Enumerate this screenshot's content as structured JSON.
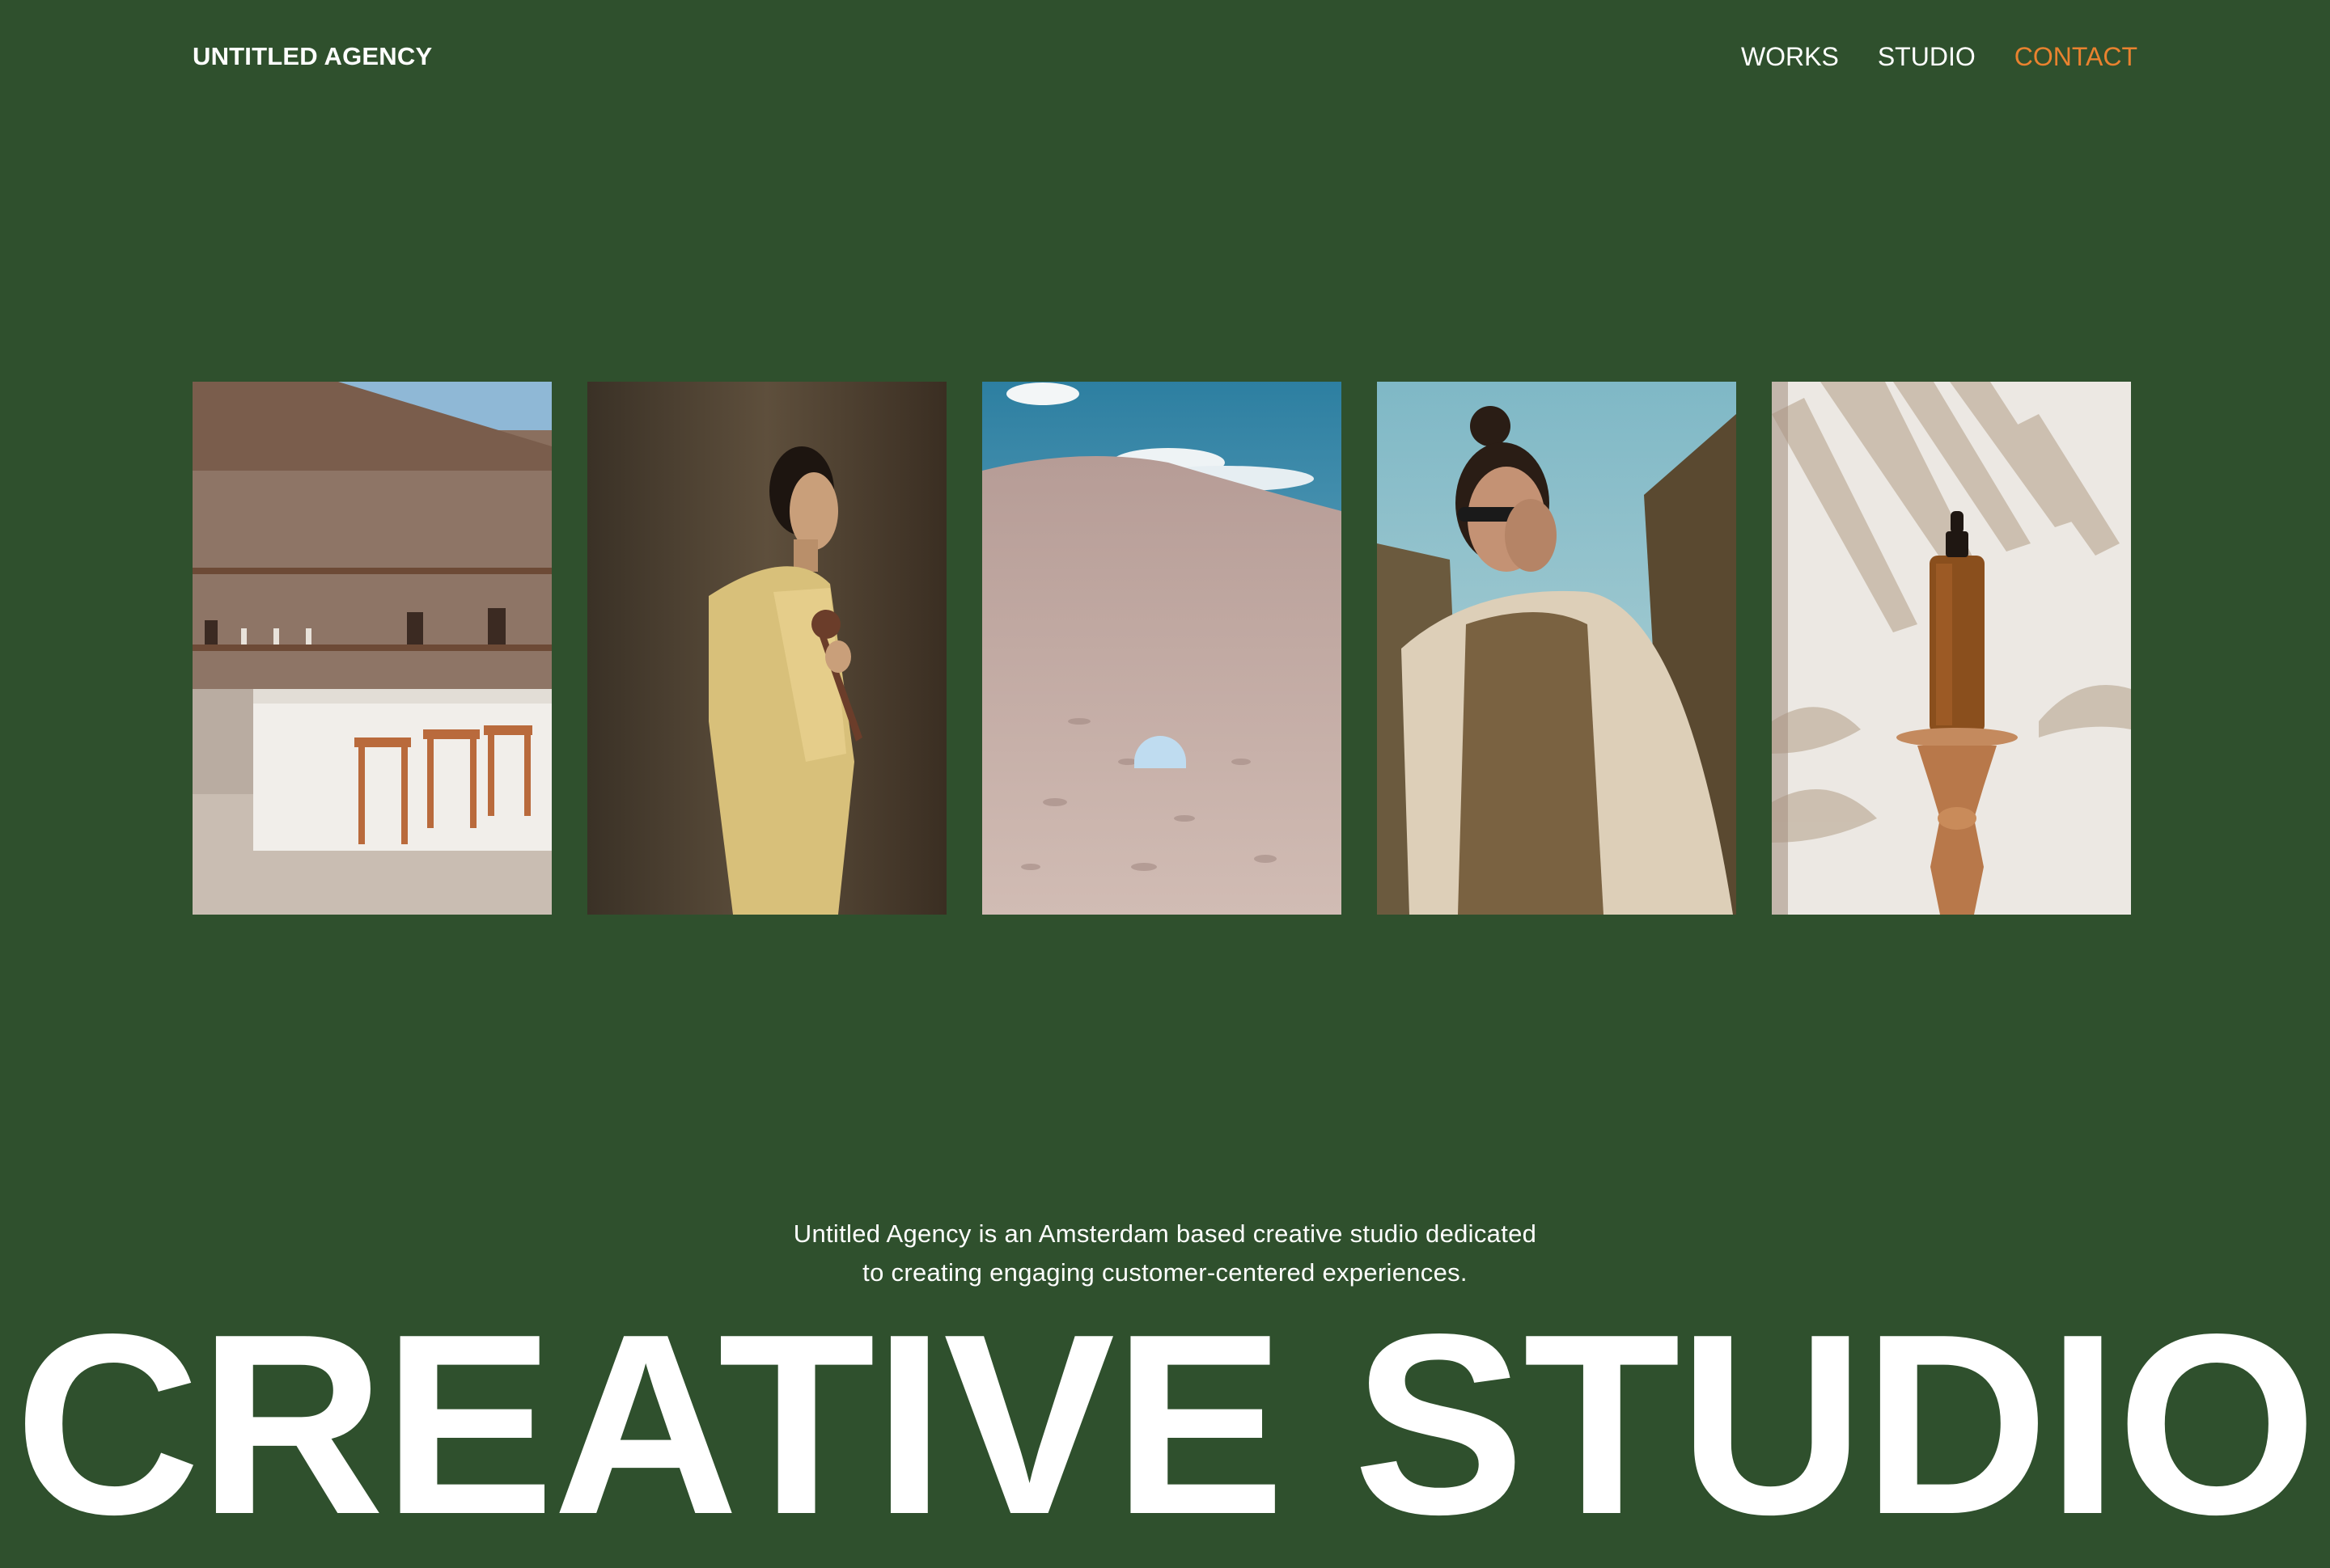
{
  "header": {
    "logo": "UNTITLED AGENCY",
    "nav": [
      {
        "label": "WORKS",
        "active": false
      },
      {
        "label": "STUDIO",
        "active": false
      },
      {
        "label": "CONTACT",
        "active": true
      }
    ]
  },
  "gallery": {
    "photos": [
      {
        "name": "photo-kitchen-bar"
      },
      {
        "name": "photo-woman-profile"
      },
      {
        "name": "photo-desert-dune"
      },
      {
        "name": "photo-woman-sunglasses"
      },
      {
        "name": "photo-serum-bottle"
      }
    ]
  },
  "about": {
    "line1": "Untitled Agency is an Amsterdam based creative studio dedicated",
    "line2": "to creating engaging customer-centered experiences."
  },
  "hero": {
    "title": "CREATIVE STUDIO"
  },
  "colors": {
    "background": "#2f502d",
    "accent": "#e9822f",
    "text": "#ffffff"
  }
}
